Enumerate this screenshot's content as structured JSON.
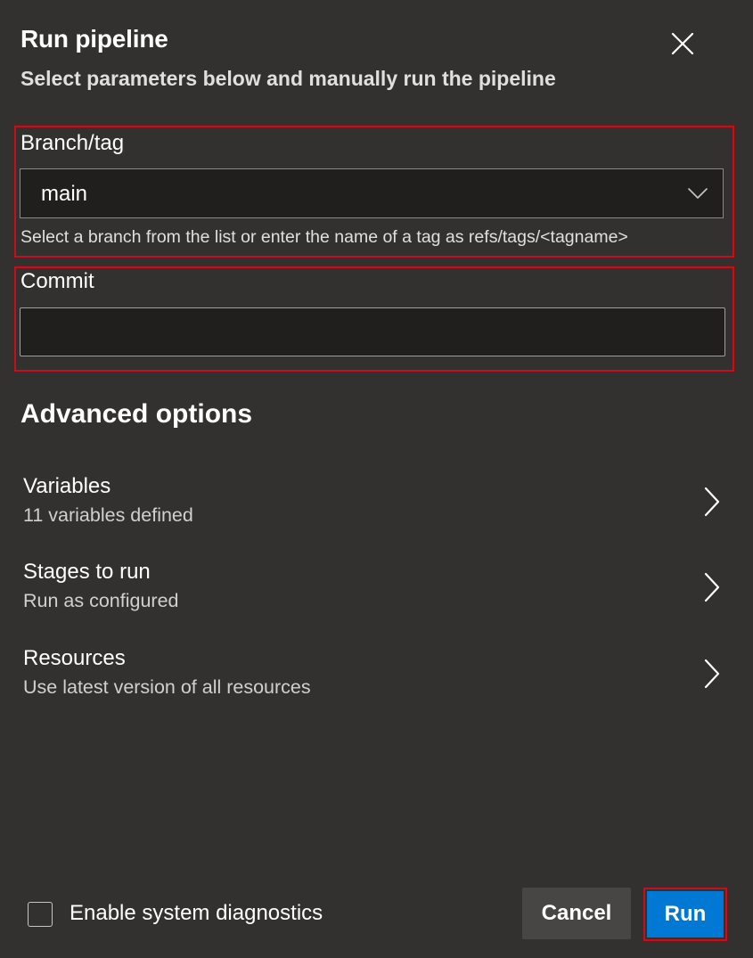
{
  "dialog": {
    "title": "Run pipeline",
    "subtitle": "Select parameters below and manually run the pipeline"
  },
  "icons": {
    "close": "close-icon",
    "dropdown": "chevron-down-icon",
    "option": "chevron-right-icon"
  },
  "branch": {
    "label": "Branch/tag",
    "value": "main",
    "helper": "Select a branch from the list or enter the name of a tag as refs/tags/<tagname>"
  },
  "commit": {
    "label": "Commit",
    "value": "",
    "placeholder": ""
  },
  "advanced": {
    "title": "Advanced options",
    "items": [
      {
        "title": "Variables",
        "subtitle": "11 variables defined"
      },
      {
        "title": "Stages to run",
        "subtitle": "Run as configured"
      },
      {
        "title": "Resources",
        "subtitle": "Use latest version of all resources"
      }
    ]
  },
  "footer": {
    "diagnostics_label": "Enable system diagnostics",
    "diagnostics_checked": false,
    "cancel_label": "Cancel",
    "run_label": "Run"
  },
  "colors": {
    "background": "#323130",
    "input_background": "#201f1e",
    "highlight_border": "#c50f1f",
    "primary_button": "#0078d4",
    "secondary_button": "#484644"
  }
}
